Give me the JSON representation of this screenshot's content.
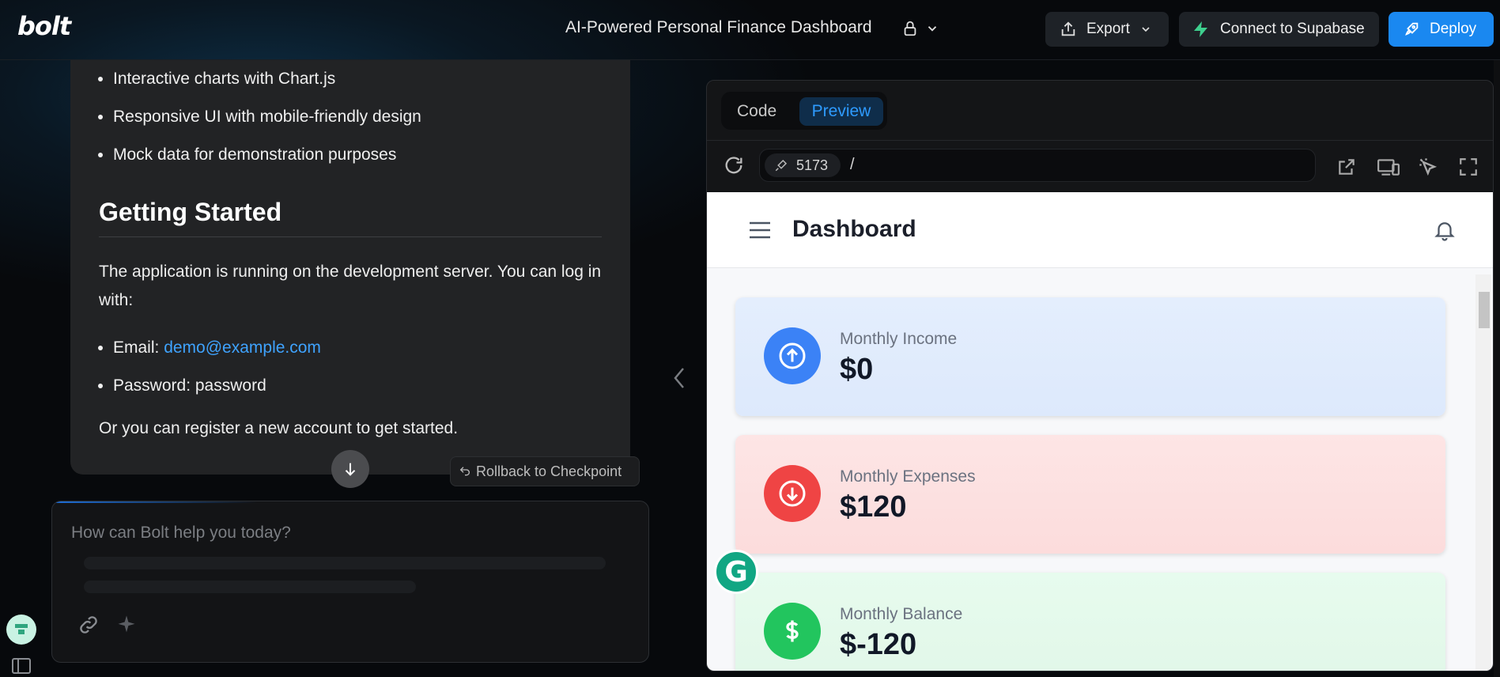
{
  "topbar": {
    "logo": "bolt",
    "project_title": "AI-Powered Personal Finance Dashboard",
    "export_label": "Export",
    "supabase_label": "Connect to Supabase",
    "deploy_label": "Deploy"
  },
  "chat": {
    "bullets_top": [
      "Interactive charts with Chart.js",
      "Responsive UI with mobile-friendly design",
      "Mock data for demonstration purposes"
    ],
    "heading": "Getting Started",
    "paragraph": "The application is running on the development server. You can log in with:",
    "email_label": "Email: ",
    "email_value": "demo@example.com",
    "password_line": "Password: password",
    "closing": "Or you can register a new account to get started.",
    "rollback_label": "Rollback to Checkpoint",
    "prompt_placeholder": "How can Bolt help you today?"
  },
  "preview": {
    "tab_code": "Code",
    "tab_preview": "Preview",
    "port": "5173",
    "path": "/"
  },
  "app": {
    "title": "Dashboard",
    "cards": [
      {
        "label": "Monthly Income",
        "value": "$0",
        "color": "#3b82f6",
        "icon": "arrow-up-circle-icon"
      },
      {
        "label": "Monthly Expenses",
        "value": "$120",
        "color": "#ef4444",
        "icon": "arrow-down-circle-icon"
      },
      {
        "label": "Monthly Balance",
        "value": "$-120",
        "color": "#22c55e",
        "icon": "dollar-icon"
      }
    ]
  },
  "colors": {
    "accent": "#1a88f0",
    "link": "#3fa3ff"
  }
}
